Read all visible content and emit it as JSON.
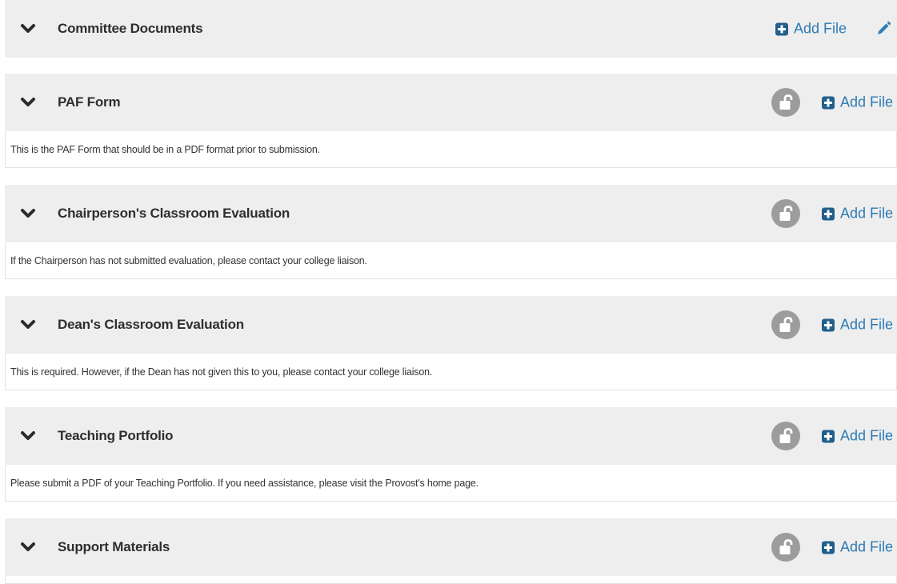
{
  "sections": [
    {
      "title": "Committee Documents",
      "add_label": "Add File",
      "description": ""
    },
    {
      "title": "PAF Form",
      "add_label": "Add File",
      "description": "This is the PAF Form that should be in a PDF format prior to submission."
    },
    {
      "title": "Chairperson's Classroom Evaluation",
      "add_label": "Add File",
      "description": "If the Chairperson has not submitted evaluation, please contact your college liaison."
    },
    {
      "title": "Dean's Classroom Evaluation",
      "add_label": "Add File",
      "description": "This is required. However, if the Dean has not given this to you, please contact your college liaison."
    },
    {
      "title": "Teaching Portfolio",
      "add_label": "Add File",
      "description": "Please submit a PDF of your Teaching Portfolio. If you need assistance, please visit the Provost's home page."
    },
    {
      "title": "Support Materials",
      "add_label": "Add File",
      "description": ""
    }
  ],
  "icons": {
    "collapse": "chevron-down-icon",
    "add": "plus-square-icon",
    "edit": "pencil-icon",
    "lock": "unlock-icon"
  },
  "colors": {
    "header_bg": "#eeeeee",
    "link": "#2d7bb4",
    "plus_icon": "#215f8c",
    "lock_bg": "#9c9c9c"
  }
}
